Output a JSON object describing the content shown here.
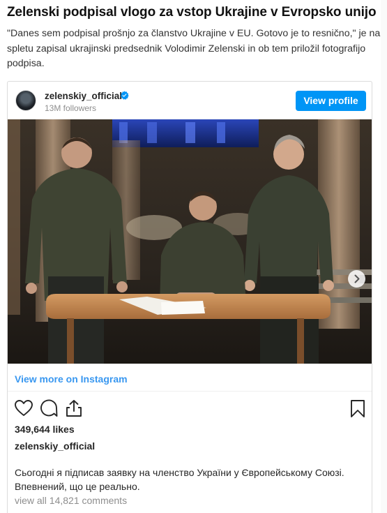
{
  "article": {
    "headline": "Zelenski podpisal vlogo za vstop Ukrajine v Evropsko unijo",
    "lede": "\"Danes sem podpisal prošnjo za članstvo Ukrajine v EU. Gotovo je to resnično,\" je na spletu zapisal ukrajinski predsednik Volodimir Zelenski in ob tem priložil fotografijo podpisa."
  },
  "embed": {
    "username": "zelenskiy_official",
    "followers": "13M followers",
    "view_profile_label": "View profile",
    "view_more_label": "View more on Instagram",
    "likes": "349,644 likes",
    "caption_author": "zelenskiy_official",
    "caption": "Сьогодні я підписав заявку на членство України у Європейському Союзі. Впевнений, що це реально.",
    "comments_link": "view all 14,821 comments",
    "carousel": {
      "total": 3,
      "active": 1
    },
    "icons": {
      "verified": "verified-badge-icon",
      "like": "heart-icon",
      "comment": "comment-bubble-icon",
      "share": "share-icon",
      "save": "bookmark-icon",
      "next": "chevron-right-icon"
    },
    "colors": {
      "accent": "#0095f6",
      "link": "#3897f0",
      "muted": "#8e8e8e"
    }
  }
}
